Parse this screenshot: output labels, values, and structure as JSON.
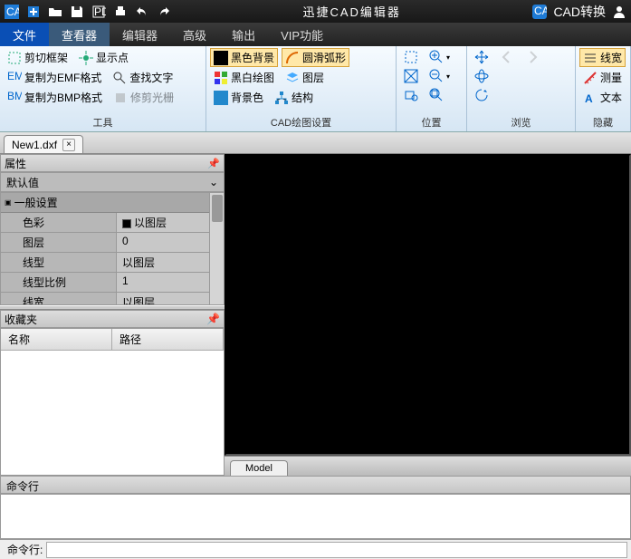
{
  "titlebar": {
    "title": "迅捷CAD编辑器",
    "convert": "CAD转换"
  },
  "menu": {
    "file": "文件",
    "viewer": "查看器",
    "editor": "编辑器",
    "advanced": "高级",
    "output": "输出",
    "vip": "VIP功能"
  },
  "ribbon": {
    "tools": {
      "clipFrame": "剪切框架",
      "copyEMF": "复制为EMF格式",
      "copyBMP": "复制为BMP格式",
      "showPoint": "显示点",
      "findText": "查找文字",
      "trimRaster": "修剪光栅",
      "label": "工具"
    },
    "draw": {
      "blackBg": "黑色背景",
      "smoothArc": "圆滑弧形",
      "bwDraw": "黑白绘图",
      "layers": "图层",
      "bgColor": "背景色",
      "struct": "结构",
      "label": "CAD绘图设置"
    },
    "pos": {
      "label": "位置"
    },
    "browse": {
      "label": "浏览"
    },
    "hide": {
      "wire": "线宽",
      "measure": "测量",
      "text": "文本",
      "label": "隐藏"
    }
  },
  "doc": {
    "name": "New1.dxf"
  },
  "props": {
    "panel": "属性",
    "default": "默认值",
    "group": "一般设置",
    "rows": [
      {
        "k": "色彩",
        "v": "以图层",
        "swatch": true
      },
      {
        "k": "图层",
        "v": "0"
      },
      {
        "k": "线型",
        "v": "以图层"
      },
      {
        "k": "线型比例",
        "v": "1"
      },
      {
        "k": "线宽",
        "v": "以图层"
      }
    ]
  },
  "fav": {
    "panel": "收藏夹",
    "col1": "名称",
    "col2": "路径"
  },
  "model": "Model",
  "cmd": {
    "panel": "命令行",
    "label": "命令行:",
    "value": ""
  }
}
